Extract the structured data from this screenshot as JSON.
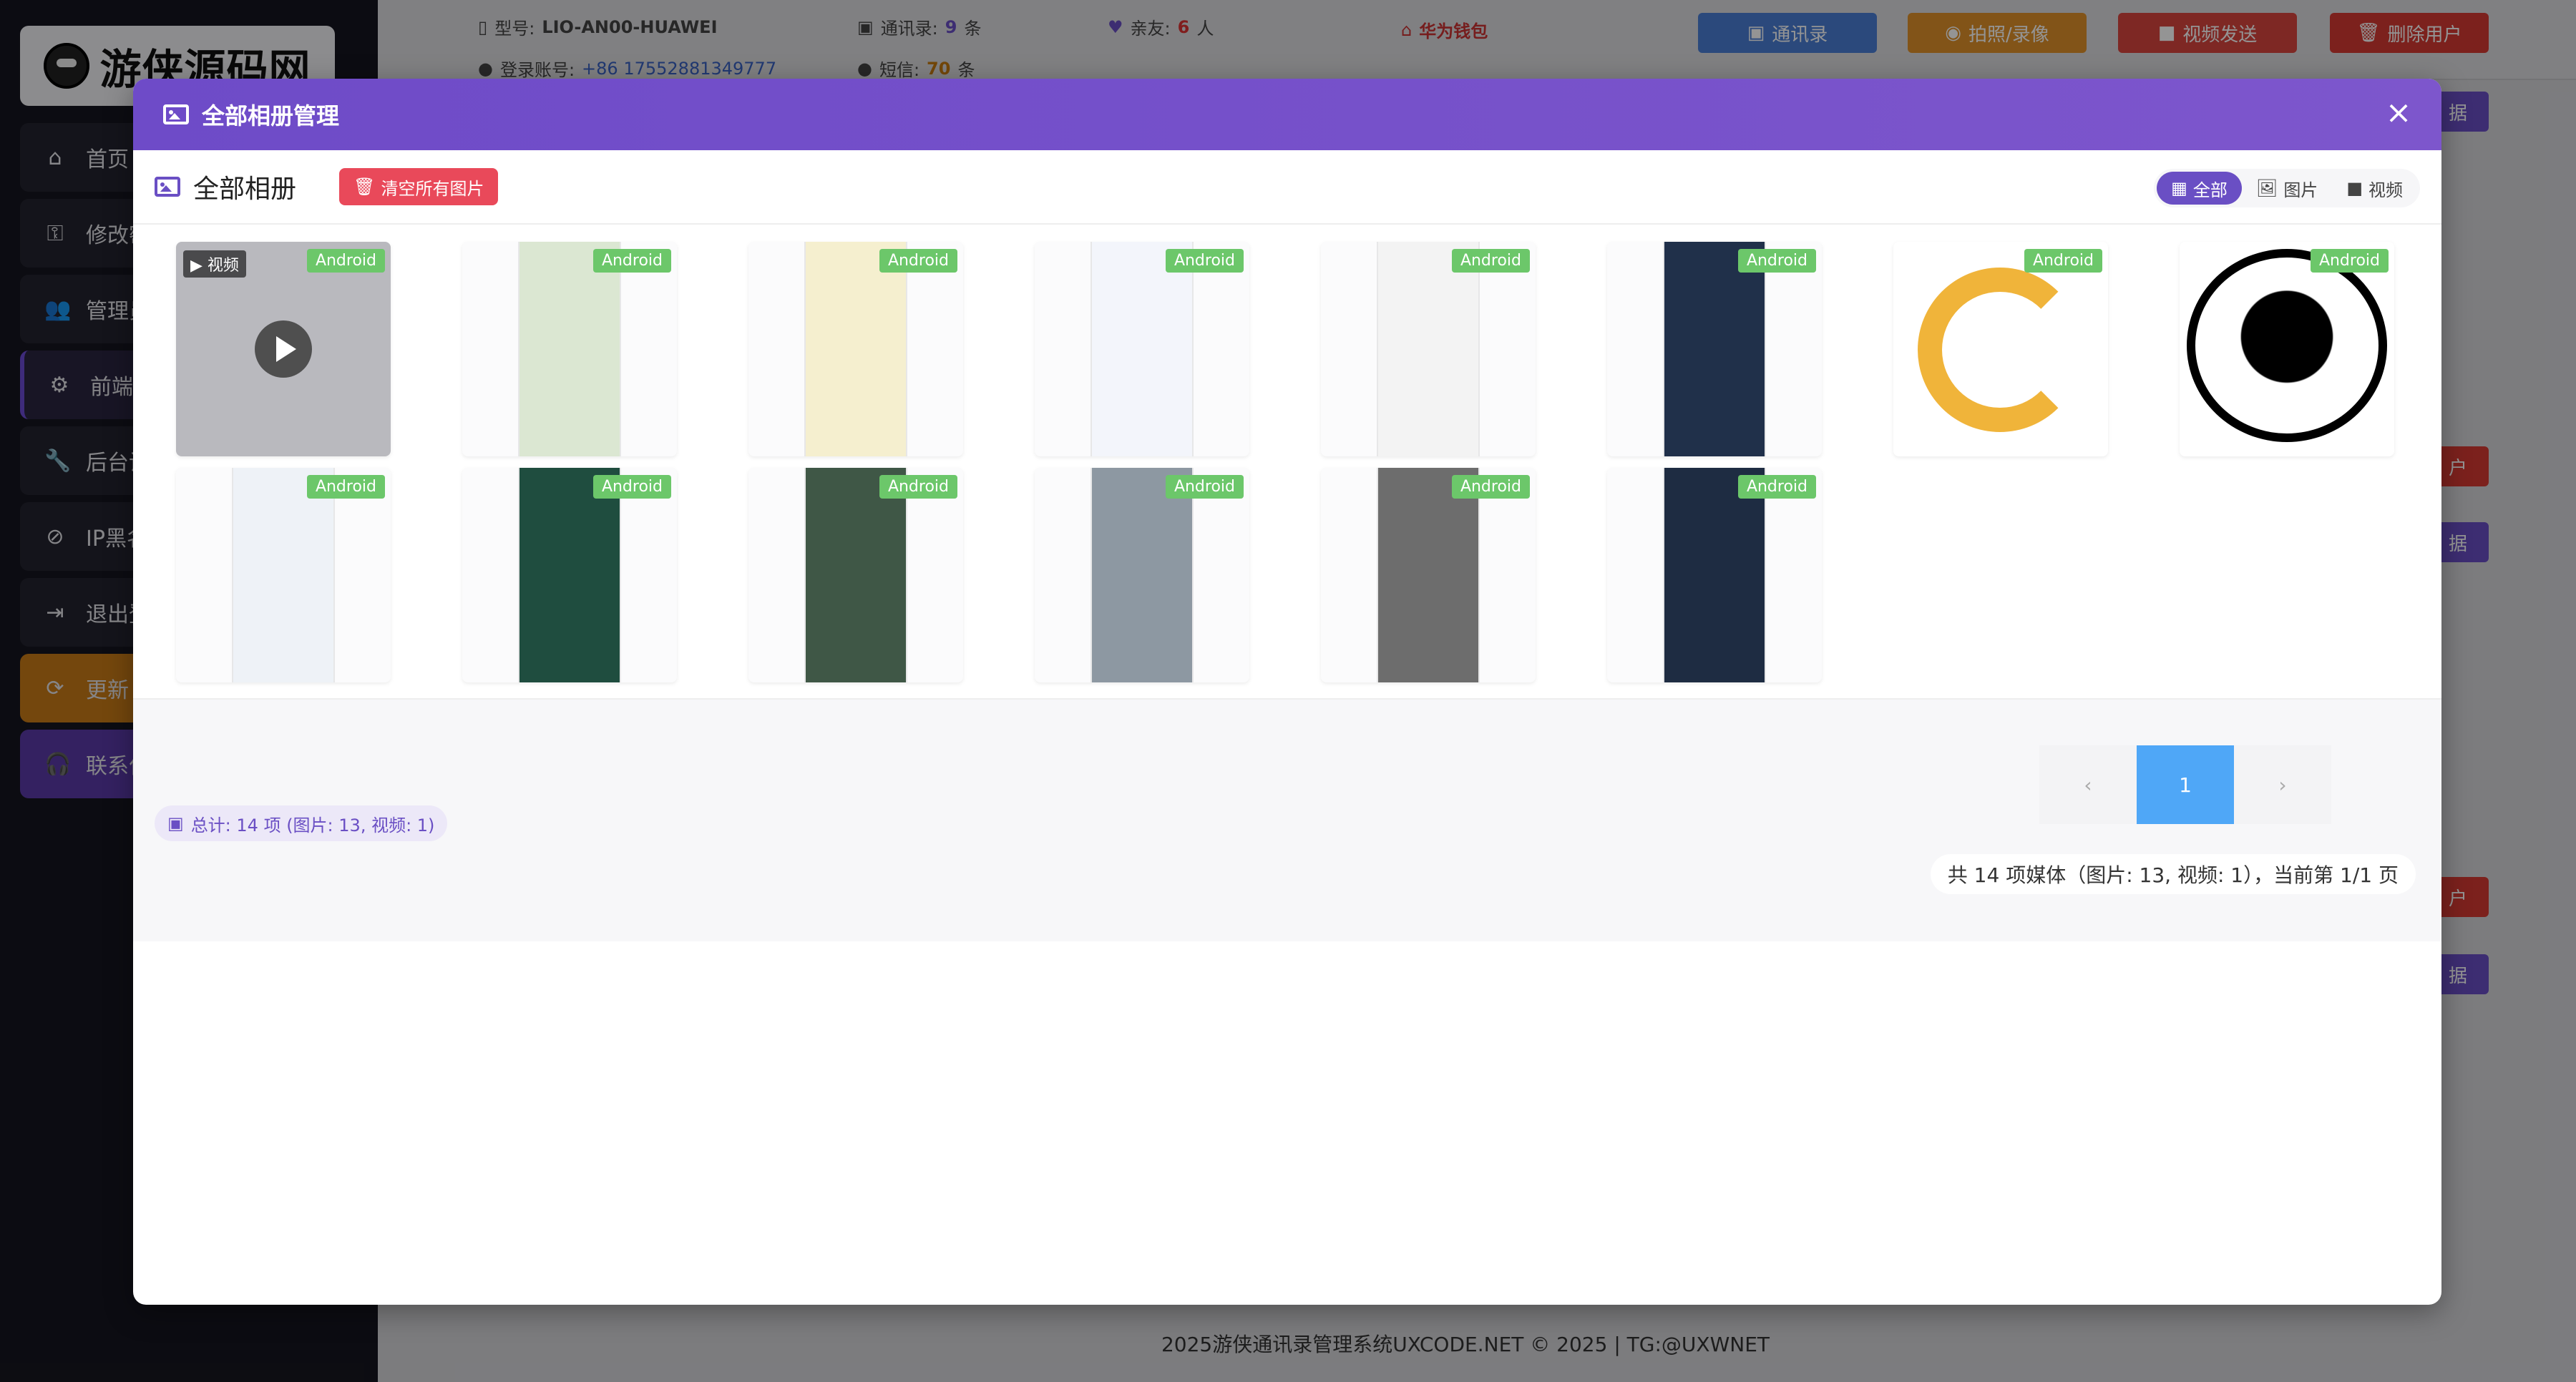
{
  "sidebar": {
    "logo_text": "游侠源码网",
    "items": [
      {
        "label": "首页",
        "icon": "home-icon",
        "glyph": "⌂"
      },
      {
        "label": "修改密",
        "icon": "key-icon",
        "glyph": "⚿"
      },
      {
        "label": "管理员",
        "icon": "users-icon",
        "glyph": "👥"
      },
      {
        "label": "前端A",
        "icon": "gear-icon",
        "glyph": "⚙"
      },
      {
        "label": "后台设",
        "icon": "wrench-icon",
        "glyph": "🔧"
      },
      {
        "label": "IP黑名",
        "icon": "ban-icon",
        "glyph": "⊘"
      },
      {
        "label": "退出登",
        "icon": "logout-icon",
        "glyph": "⇥"
      },
      {
        "label": "更新",
        "icon": "refresh-icon",
        "glyph": "⟳"
      },
      {
        "label": "联系作",
        "icon": "headset-icon",
        "glyph": "🎧"
      }
    ]
  },
  "background": {
    "model_label": "型号:",
    "model_value": "LIO-AN00-HUAWEI",
    "account_label": "登录账号:",
    "account_value": "+86 17552881349777",
    "contacts_label": "通讯录:",
    "contacts_value": "9",
    "contacts_unit": "条",
    "sms_label": "短信:",
    "sms_value": "70",
    "sms_unit": "条",
    "family_label": "亲友:",
    "family_value": "6",
    "family_unit": "人",
    "wallet_label": "华为钱包",
    "btn_contacts": "通讯录",
    "btn_photo": "拍照/录像",
    "btn_video": "视频发送",
    "btn_delete": "删除用户",
    "btn_data_tail": "据",
    "btn_user_tail": "户"
  },
  "modal": {
    "title": "全部相册管理",
    "album_title": "全部相册",
    "clear_button": "清空所有图片",
    "filters": [
      {
        "label": "全部",
        "icon": "grid-icon",
        "glyph": "▦",
        "active": true
      },
      {
        "label": "图片",
        "icon": "image-icon",
        "glyph": "🖼",
        "active": false
      },
      {
        "label": "视频",
        "icon": "video-icon",
        "glyph": "■",
        "active": false
      }
    ],
    "video_tag": "▶ 视频",
    "platform_badge": "Android",
    "tiles": [
      {
        "kind": "video",
        "thumb_color": "#b9b9be"
      },
      {
        "kind": "image",
        "thumb_color": "#dbe7d2"
      },
      {
        "kind": "image",
        "thumb_color": "#f5efcf"
      },
      {
        "kind": "image",
        "thumb_color": "#f3f5fb"
      },
      {
        "kind": "image",
        "thumb_color": "#f3f3f3"
      },
      {
        "kind": "image",
        "thumb_color": "#20304a"
      },
      {
        "kind": "image",
        "thumb_color": "#ffffff"
      },
      {
        "kind": "image",
        "thumb_color": "#ffffff"
      },
      {
        "kind": "image",
        "thumb_color": "#eef2f7"
      },
      {
        "kind": "image",
        "thumb_color": "#1f4d3f"
      },
      {
        "kind": "image",
        "thumb_color": "#3f5746"
      },
      {
        "kind": "image",
        "thumb_color": "#8d98a2"
      },
      {
        "kind": "image",
        "thumb_color": "#6d6d6d"
      },
      {
        "kind": "image",
        "thumb_color": "#1e2c42"
      }
    ],
    "total_chip": "总计: 14 项 (图片: 13, 视频: 1)",
    "pager": {
      "prev": "‹",
      "current": "1",
      "next": "›"
    },
    "summary": "共 14 项媒体（图片: 13, 视频: 1），当前第 1/1 页"
  },
  "footer": "2025游侠通讯录管理系统UXCODE.NET © 2025 | TG:@UXWNET",
  "colors": {
    "modal_header": "#6e4bc8",
    "badge_green": "#6cc76a",
    "danger": "#e9495a",
    "pager_active": "#4fa7f7"
  }
}
